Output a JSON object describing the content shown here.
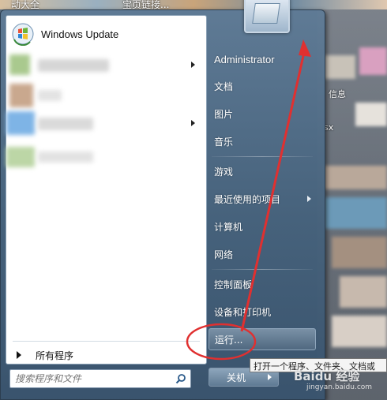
{
  "desktop": {
    "top_labels": [
      "动大全",
      "宝页链接..."
    ],
    "icon_labels": [
      "信息",
      "sx"
    ]
  },
  "left_pane": {
    "pinned": [
      {
        "label": "Windows Update",
        "icon": "windows-update-icon"
      }
    ],
    "all_programs_label": "所有程序",
    "search_placeholder": "搜索程序和文件"
  },
  "right_pane": {
    "user": "Administrator",
    "items": [
      {
        "label": "文档"
      },
      {
        "label": "图片"
      },
      {
        "label": "音乐"
      },
      {
        "label": "游戏"
      },
      {
        "label": "最近使用的项目"
      },
      {
        "label": "计算机"
      },
      {
        "label": "网络"
      },
      {
        "label": "控制面板"
      },
      {
        "label": "设备和打印机"
      }
    ],
    "run_label": "运行...",
    "shutdown_label": "关机"
  },
  "tooltip": "打开一个程序、文件夹、文档或",
  "watermark": {
    "brand": "Baidu 经验",
    "url": "jingyan.baidu.com"
  },
  "colors": {
    "annotation": "#e03030",
    "menu_right": "#5f7b96",
    "left_pane_bg": "#ffffff"
  }
}
